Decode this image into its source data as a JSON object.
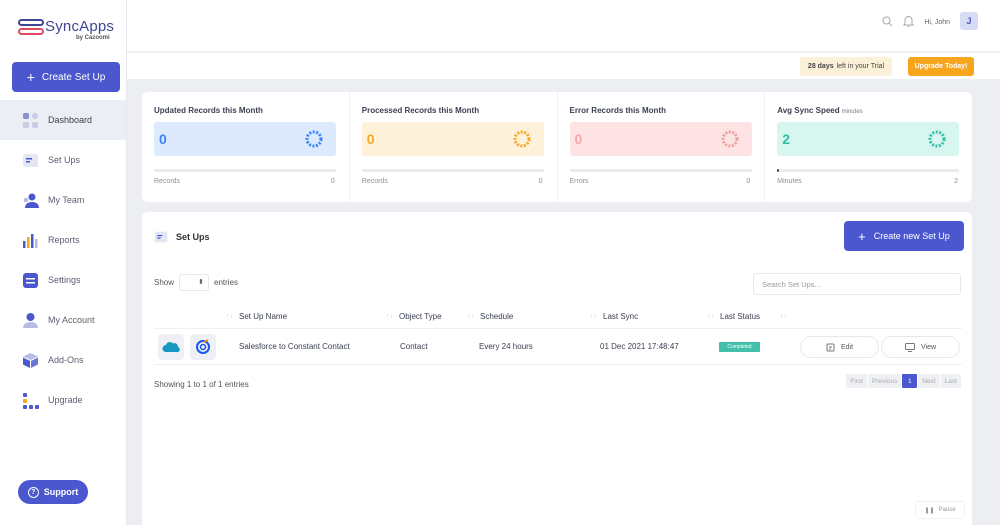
{
  "brand": {
    "name": "SyncApps",
    "sub": "by Cazoomi",
    "accent": "#4a57cf",
    "logo_color": "#3d4596"
  },
  "sidebar": {
    "create_label": "Create Set Up",
    "items": [
      {
        "label": "Dashboard",
        "icon": "dashboard-icon"
      },
      {
        "label": "Set Ups",
        "icon": "setups-icon"
      },
      {
        "label": "My Team",
        "icon": "team-icon"
      },
      {
        "label": "Reports",
        "icon": "reports-icon"
      },
      {
        "label": "Settings",
        "icon": "settings-icon"
      },
      {
        "label": "My Account",
        "icon": "account-icon"
      },
      {
        "label": "Add-Ons",
        "icon": "addons-icon"
      },
      {
        "label": "Upgrade",
        "icon": "upgrade-icon"
      }
    ],
    "active": "Dashboard",
    "support_label": "Support"
  },
  "header": {
    "greeting": "Hi, John",
    "avatar_initial": "J",
    "trial_days": "28 days",
    "trial_text": "left in your Trial",
    "upgrade_label": "Upgrade Today!",
    "upgrade_color": "#f7a51c"
  },
  "stats": [
    {
      "title": "Updated Records this Month",
      "unit": "",
      "value": "0",
      "foot_label": "Records",
      "foot_value": "0",
      "bg": "#ddeafd",
      "color": "#3b82f6"
    },
    {
      "title": "Processed Records this Month",
      "unit": "",
      "value": "0",
      "foot_label": "Records",
      "foot_value": "0",
      "bg": "#fdf1d9",
      "color": "#f5a623"
    },
    {
      "title": "Error Records this Month",
      "unit": "",
      "value": "0",
      "foot_label": "Errors",
      "foot_value": "0",
      "bg": "#fde3e3",
      "color": "#f4a8a8"
    },
    {
      "title": "Avg Sync Speed",
      "unit": "minutes",
      "value": "2",
      "foot_label": "Minutes",
      "foot_value": "2",
      "bg": "#d8f6f0",
      "color": "#2fbfa5"
    }
  ],
  "setups": {
    "title": "Set Ups",
    "new_label": "Create new Set Up",
    "show_label": "Show",
    "entries_label": "entries",
    "search_placeholder": "Search Set Ups...",
    "columns": [
      "Set Up Name",
      "Object Type",
      "Schedule",
      "Last Sync",
      "Last Status"
    ],
    "rows": [
      {
        "name": "Salesforce to Constant Contact",
        "object_type": "Contact",
        "schedule": "Every 24 hours",
        "last_sync": "01 Dec 2021 17:48:47",
        "status": "Completed",
        "status_color": "#43c0a9",
        "edit_label": "Edit",
        "view_label": "View"
      }
    ],
    "info": "Showing 1 to 1 of 1 entries",
    "pager": [
      "First",
      "Previous",
      "1",
      "Next",
      "Last"
    ],
    "pause_label": "Pause"
  }
}
